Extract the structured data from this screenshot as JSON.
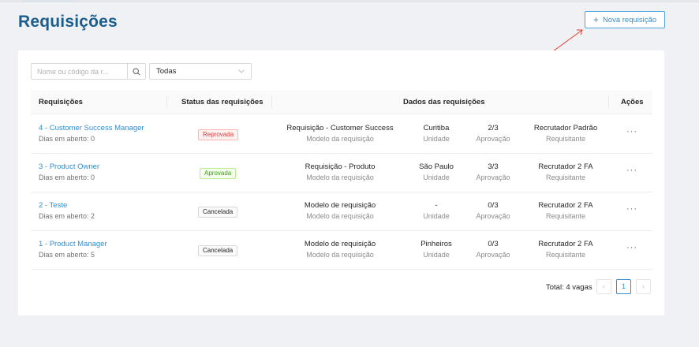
{
  "page": {
    "title": "Requisições"
  },
  "actions": {
    "new_label": "Nova requisição",
    "plus": "+"
  },
  "filters": {
    "search_placeholder": "Nome ou código da r...",
    "status_selected": "Todas"
  },
  "table": {
    "headers": {
      "requisicoes": "Requisições",
      "status": "Status das requisições",
      "dados": "Dados das requisições",
      "acoes": "Ações"
    },
    "rows": [
      {
        "title": "4 - Customer Success Manager",
        "days": "Dias em aberto: 0",
        "status": "Reprovada",
        "model_value": "Requisição - Customer Success",
        "model_label": "Modelo da requisição",
        "unit_value": "Curitiba",
        "unit_label": "Unidade",
        "approval_value": "2/3",
        "approval_label": "Aprovação",
        "requester_value": "Recrutador Padrão",
        "requester_label": "Requisitante",
        "actions": "···"
      },
      {
        "title": "3 - Product Owner",
        "days": "Dias em aberto: 0",
        "status": "Aprovada",
        "model_value": "Requisição - Produto",
        "model_label": "Modelo da requisição",
        "unit_value": "São Paulo",
        "unit_label": "Unidade",
        "approval_value": "3/3",
        "approval_label": "Aprovação",
        "requester_value": "Recrutador 2 FA",
        "requester_label": "Requisitante",
        "actions": "···"
      },
      {
        "title": "2 - Teste",
        "days": "Dias em aberto: 2",
        "status": "Cancelada",
        "model_value": "Modelo de requisição",
        "model_label": "Modelo da requisição",
        "unit_value": "-",
        "unit_label": "Unidade",
        "approval_value": "0/3",
        "approval_label": "Aprovação",
        "requester_value": "Recrutador 2 FA",
        "requester_label": "Requisitante",
        "actions": "···"
      },
      {
        "title": "1 - Product Manager",
        "days": "Dias em aberto: 5",
        "status": "Cancelada",
        "model_value": "Modelo de requisição",
        "model_label": "Modelo da requisição",
        "unit_value": "Pinheiros",
        "unit_label": "Unidade",
        "approval_value": "0/3",
        "approval_label": "Aprovação",
        "requester_value": "Recrutador 2 FA",
        "requester_label": "Requisitante",
        "actions": "···"
      }
    ]
  },
  "pagination": {
    "total": "Total: 4 vagas",
    "prev": "‹",
    "current": "1",
    "next": "›"
  },
  "colors": {
    "title": "#1b5e8c",
    "link": "#2f8fd6",
    "rejected": "#e03c3c",
    "approved": "#3a9d14",
    "annotation_arrow": "#e23b2e"
  },
  "icons": {
    "search": "search-icon",
    "select": "chevron-down-icon",
    "add": "plus-icon",
    "more": "more-dots-icon"
  }
}
